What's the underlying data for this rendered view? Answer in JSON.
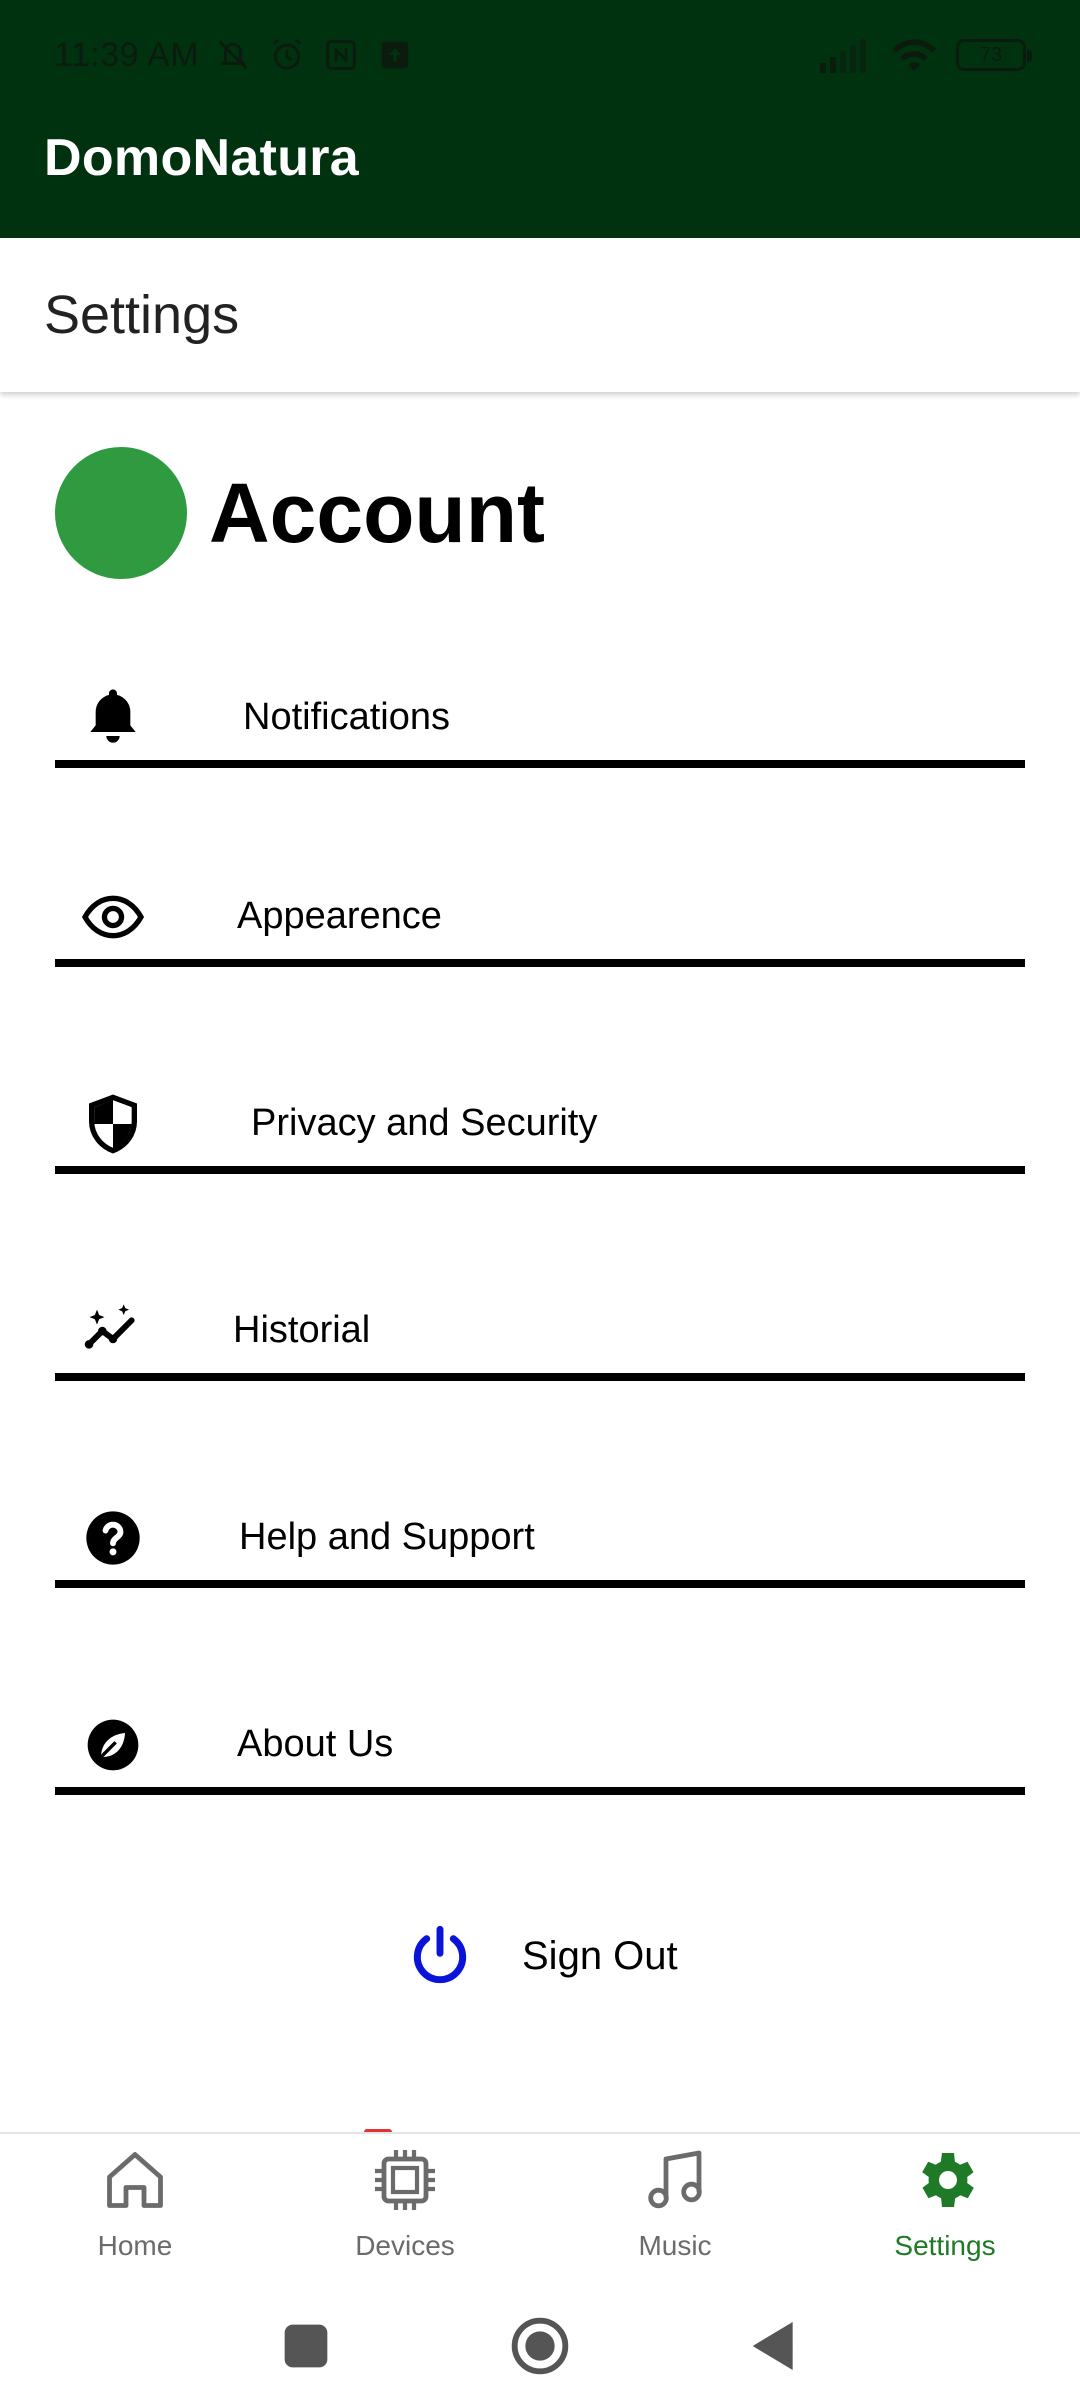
{
  "status_bar": {
    "time": "11:39 AM",
    "battery": "73"
  },
  "app": {
    "title": "DomoNatura"
  },
  "page": {
    "title": "Settings"
  },
  "account": {
    "title": "Account",
    "avatar_color": "#2f9a40"
  },
  "menu": [
    {
      "label": "Notifications",
      "icon": "bell-icon"
    },
    {
      "label": "Appearence",
      "icon": "eye-icon"
    },
    {
      "label": "Privacy and Security",
      "icon": "shield-icon"
    },
    {
      "label": "Historial",
      "icon": "sparkle-chart-icon"
    },
    {
      "label": "Help and Support",
      "icon": "help-circle-icon"
    },
    {
      "label": "About Us",
      "icon": "leaf-icon"
    }
  ],
  "signout": {
    "label": "Sign Out",
    "icon": "power-icon",
    "icon_color": "#0a14d8"
  },
  "bottom_nav": [
    {
      "label": "Home",
      "icon": "home-icon"
    },
    {
      "label": "Devices",
      "icon": "chip-icon"
    },
    {
      "label": "Music",
      "icon": "music-note-icon"
    },
    {
      "label": "Settings",
      "icon": "gear-icon",
      "active": true
    }
  ],
  "colors": {
    "appbar": "#003210",
    "active_nav": "#1e7a27",
    "inactive_nav": "#6b6b6b"
  }
}
